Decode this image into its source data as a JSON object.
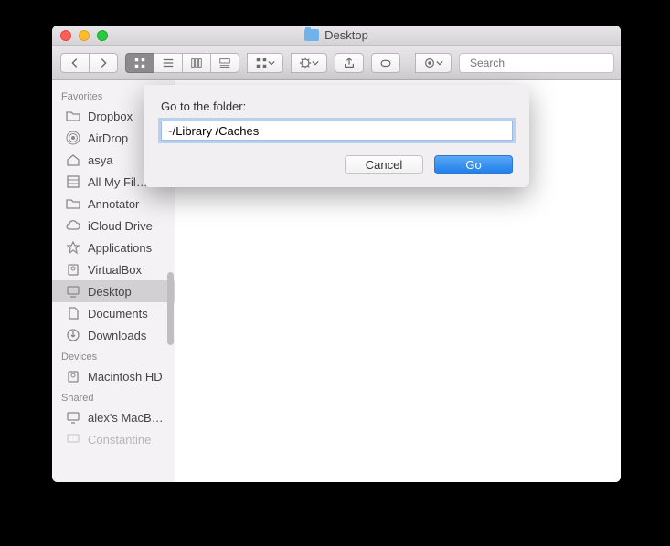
{
  "window": {
    "title": "Desktop"
  },
  "toolbar": {
    "search_placeholder": "Search"
  },
  "sidebar": {
    "sections": {
      "favorites": "Favorites",
      "devices": "Devices",
      "shared": "Shared"
    },
    "favorites": [
      {
        "label": "Dropbox",
        "icon": "folder"
      },
      {
        "label": "AirDrop",
        "icon": "airdrop"
      },
      {
        "label": "asya",
        "icon": "home"
      },
      {
        "label": "All My Fil…",
        "icon": "allfiles"
      },
      {
        "label": "Annotator",
        "icon": "folder"
      },
      {
        "label": "iCloud Drive",
        "icon": "cloud"
      },
      {
        "label": "Applications",
        "icon": "apps"
      },
      {
        "label": "VirtualBox",
        "icon": "disk"
      },
      {
        "label": "Desktop",
        "icon": "desktop",
        "selected": true
      },
      {
        "label": "Documents",
        "icon": "documents"
      },
      {
        "label": "Downloads",
        "icon": "downloads"
      }
    ],
    "devices": [
      {
        "label": "Macintosh HD",
        "icon": "disk"
      }
    ],
    "shared": [
      {
        "label": "alex's MacB…",
        "icon": "monitor"
      },
      {
        "label": "Constantine",
        "icon": "monitor"
      }
    ]
  },
  "sheet": {
    "label": "Go to the folder:",
    "value": "~/Library /Caches",
    "cancel": "Cancel",
    "go": "Go"
  }
}
